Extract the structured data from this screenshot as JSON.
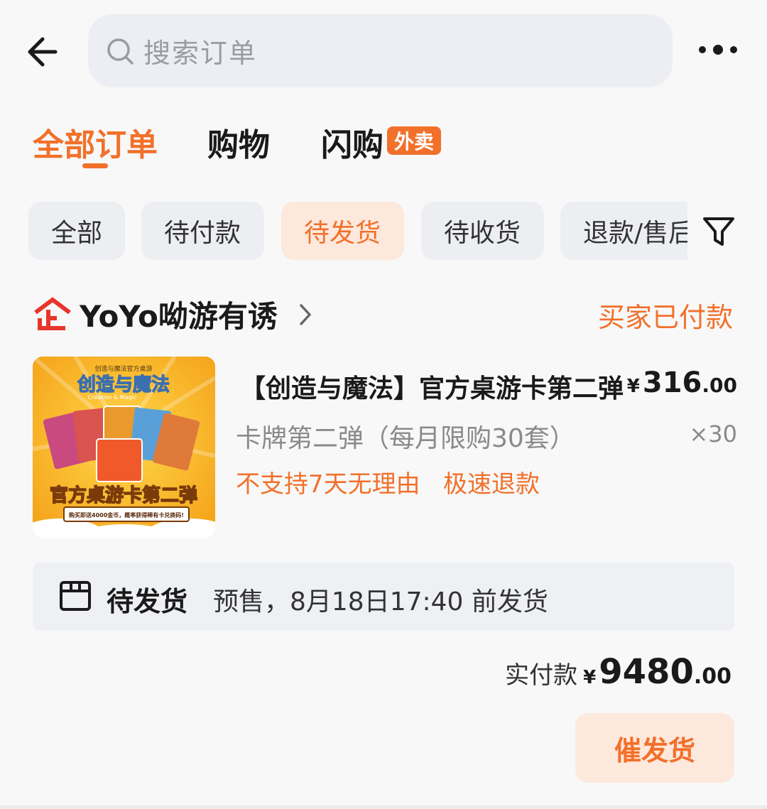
{
  "header": {
    "search_placeholder": "搜索订单"
  },
  "main_tabs": [
    {
      "label": "全部订单",
      "active": true
    },
    {
      "label": "购物",
      "active": false
    },
    {
      "label": "闪购",
      "active": false,
      "badge": "外卖"
    }
  ],
  "filter_chips": [
    {
      "label": "全部",
      "active": false
    },
    {
      "label": "待付款",
      "active": false
    },
    {
      "label": "待发货",
      "active": true
    },
    {
      "label": "待收货",
      "active": false
    },
    {
      "label": "退款/售后",
      "active": false
    }
  ],
  "order": {
    "shop_name": "YoYo呦游有诱",
    "status": "买家已付款",
    "product": {
      "title": "【创造与魔法】官方桌游卡第二弹",
      "price_symbol": "¥",
      "price_integer": "316",
      "price_decimal": ".00",
      "spec": "卡牌第二弹（每月限购30套）",
      "quantity": "×30",
      "tags": [
        "不支持7天无理由",
        "极速退款"
      ],
      "image_text": {
        "top_small": "创造与魔法官方桌游",
        "logo": "创造与魔法",
        "logo_en": "Creation & Magic",
        "banner": "官方桌游卡第二弹",
        "ribbon": "购买即送4000金币，概率获得稀有卡兑换码!"
      }
    },
    "shipping": {
      "status": "待发货",
      "description": "预售，8月18日17:40 前发货"
    },
    "total": {
      "label": "实付款",
      "symbol": "¥",
      "integer": "9480",
      "decimal": ".00"
    },
    "action_button": "催发货"
  },
  "colors": {
    "accent": "#f2702a",
    "accent_light": "#fde8dc",
    "search_bg": "#eceef3",
    "chip_bg": "#eceef2",
    "page_bg": "#f8f8f8",
    "shop_icon_red": "#e8352b"
  },
  "icons": {
    "back": "arrow-left-icon",
    "search": "search-icon",
    "more": "more-dots-icon",
    "filter": "funnel-icon",
    "shop": "enterprise-shop-icon",
    "chevron": "chevron-right-icon",
    "shipping": "package-box-icon"
  }
}
